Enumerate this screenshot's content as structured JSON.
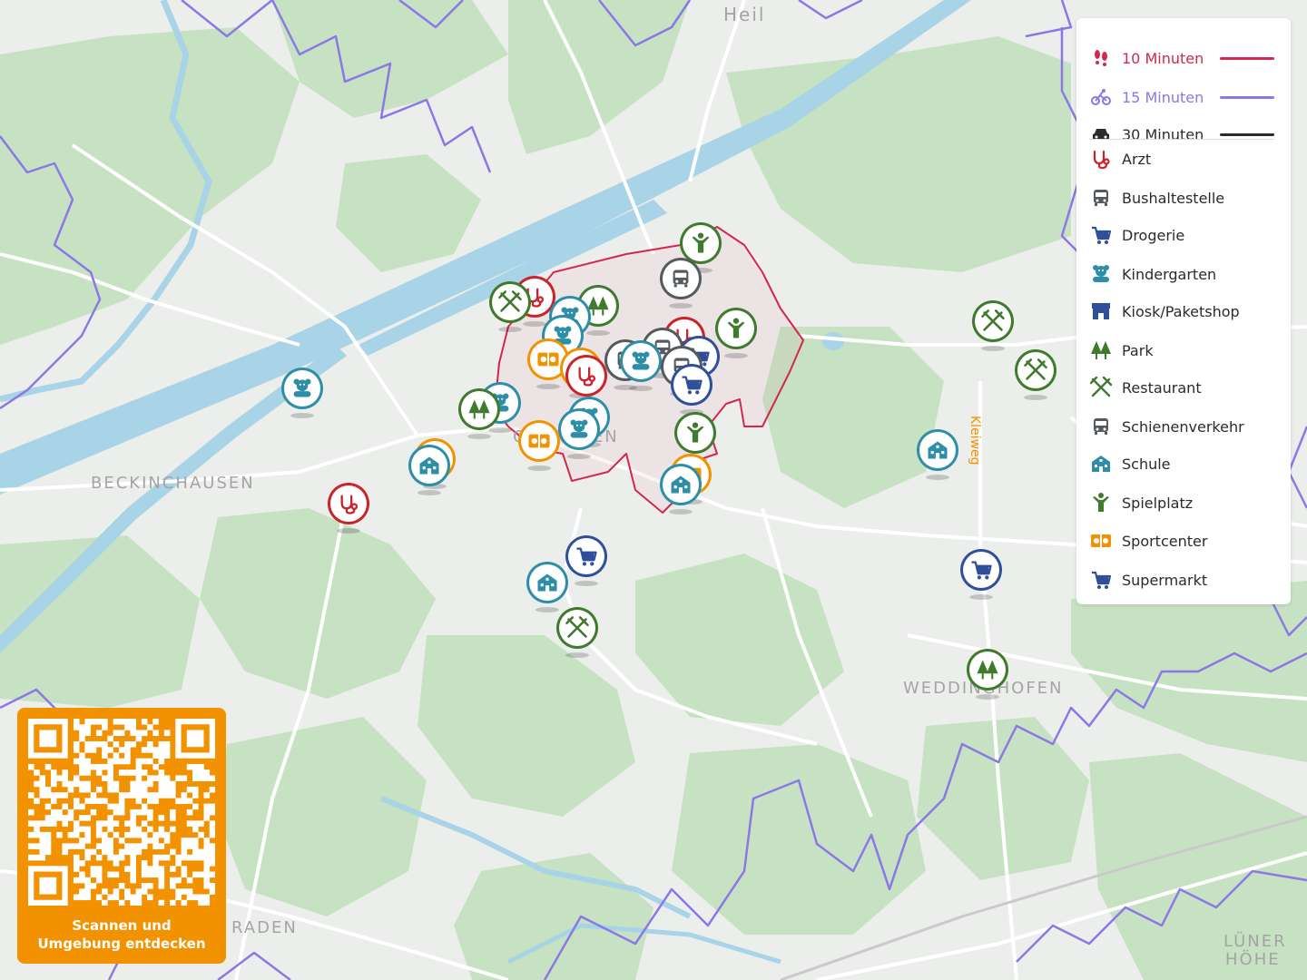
{
  "legend": {
    "isochrones": [
      {
        "label": "10 Minuten",
        "mode": "walk",
        "icon": "footprints-icon",
        "color": "#d1284f"
      },
      {
        "label": "15 Minuten",
        "mode": "bike",
        "icon": "bicycle-icon",
        "color": "#8b78e6"
      },
      {
        "label": "30 Minuten",
        "mode": "car",
        "icon": "car-icon",
        "color": "#2b2b2b"
      }
    ],
    "categories": [
      {
        "label": "Arzt",
        "icon": "stethoscope-icon",
        "color": "#c9242b"
      },
      {
        "label": "Bushaltestelle",
        "icon": "bus-icon",
        "color": "#555a5e"
      },
      {
        "label": "Drogerie",
        "icon": "cart-icon",
        "color": "#2f4f9a"
      },
      {
        "label": "Kindergarten",
        "icon": "teddy-icon",
        "color": "#2e8ea8"
      },
      {
        "label": "Kiosk/Paketshop",
        "icon": "shop-icon",
        "color": "#2f4f9a"
      },
      {
        "label": "Park",
        "icon": "trees-icon",
        "color": "#3f7a2e"
      },
      {
        "label": "Restaurant",
        "icon": "cutlery-icon",
        "color": "#3f7a2e"
      },
      {
        "label": "Schienenverkehr",
        "icon": "train-icon",
        "color": "#555a5e"
      },
      {
        "label": "Schule",
        "icon": "school-icon",
        "color": "#2e8ea8"
      },
      {
        "label": "Spielplatz",
        "icon": "playground-icon",
        "color": "#3f7a2e"
      },
      {
        "label": "Sportcenter",
        "icon": "sport-icon",
        "color": "#f39200"
      },
      {
        "label": "Supermarkt",
        "icon": "cart-icon",
        "color": "#2f4f9a"
      }
    ]
  },
  "map": {
    "place_labels": [
      "Heil",
      "BECKINCHAUSEN",
      "OBERADEN",
      "WEDDINGHOFEN",
      "Kleiweg",
      "RADEN",
      "LÜNER",
      "HÖHE"
    ]
  },
  "qr": {
    "caption_line1": "Scannen und",
    "caption_line2": "Umgebung entdecken"
  },
  "colors": {
    "walk": "#d1284f",
    "bike": "#8b78e6",
    "car": "#2b2b2b",
    "water": "#a9d3e6",
    "forest": "#c5e0c0",
    "accent": "#f39200"
  }
}
